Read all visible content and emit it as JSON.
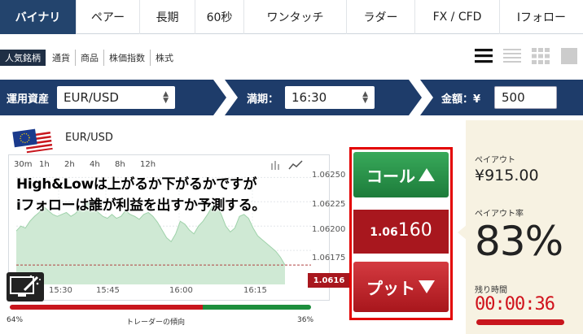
{
  "tabs": [
    {
      "label": "バイナリ",
      "active": true
    },
    {
      "label": "ペアー",
      "active": false
    },
    {
      "label": "長期",
      "active": false
    },
    {
      "label": "60秒",
      "active": false
    },
    {
      "label": "ワンタッチ",
      "active": false
    },
    {
      "label": "ラダー",
      "active": false
    },
    {
      "label": "FX / CFD",
      "active": false
    },
    {
      "label": "Iフォロー",
      "active": false
    }
  ],
  "subnav": {
    "items": [
      "人気銘柄",
      "通貨",
      "商品",
      "株価指数",
      "株式"
    ],
    "active": 0,
    "view_icons": [
      "list-view-icon",
      "compact-list-icon",
      "grid-view-icon",
      "single-view-icon"
    ]
  },
  "controls": {
    "asset_label": "運用資産",
    "asset_value": "EUR/USD",
    "expiry_label": "満期：",
    "expiry_value": "16:30",
    "amount_label": "金額：¥",
    "amount_value": "500"
  },
  "instrument": {
    "pair": "EUR/USD",
    "flag": "eu-us-flag-icon"
  },
  "chart": {
    "timeframes": [
      "30m",
      "1h",
      "2h",
      "4h",
      "8h",
      "12h"
    ],
    "price_ticks": [
      "1.06250",
      "1.06225",
      "1.06200",
      "1.06175"
    ],
    "time_ticks": [
      "15:30",
      "15:45",
      "16:00",
      "16:15"
    ],
    "current_price": "1.0616"
  },
  "chart_data": {
    "type": "area",
    "x": [
      0,
      1,
      2,
      3,
      4,
      5,
      6,
      7,
      8,
      9,
      10,
      11,
      12,
      13,
      14,
      15,
      16,
      17,
      18,
      19,
      20,
      21,
      22,
      23,
      24,
      25,
      26,
      27,
      28,
      29,
      30,
      31,
      32,
      33,
      34,
      35,
      36,
      37,
      38,
      39,
      40,
      41,
      42,
      43,
      44,
      45,
      46,
      47,
      48,
      49,
      50,
      51,
      52,
      53,
      54,
      55,
      56,
      57,
      58,
      59
    ],
    "values": [
      1.06195,
      1.062,
      1.06198,
      1.06205,
      1.0621,
      1.06214,
      1.0622,
      1.06216,
      1.06212,
      1.0621,
      1.06212,
      1.06214,
      1.0621,
      1.06213,
      1.06218,
      1.06222,
      1.06224,
      1.0622,
      1.06214,
      1.0621,
      1.06208,
      1.06212,
      1.06208,
      1.0621,
      1.06216,
      1.06212,
      1.0621,
      1.06207,
      1.06212,
      1.06214,
      1.0621,
      1.06204,
      1.06196,
      1.06188,
      1.06184,
      1.06192,
      1.06205,
      1.06202,
      1.06196,
      1.06192,
      1.062,
      1.06205,
      1.06212,
      1.0622,
      1.06222,
      1.06212,
      1.062,
      1.06194,
      1.06198,
      1.0621,
      1.06212,
      1.06208,
      1.06198,
      1.0619,
      1.06186,
      1.06182,
      1.06178,
      1.06174,
      1.06168,
      1.0616
    ],
    "ylim": [
      1.0614,
      1.06262
    ],
    "xticks": [
      "15:30",
      "15:45",
      "16:00",
      "16:15"
    ],
    "yticks": [
      "1.06250",
      "1.06225",
      "1.06200",
      "1.06175"
    ],
    "grid": true
  },
  "overlay": {
    "line1": "High&Lowは上がるか下がるかですが",
    "line2": "iフォローは誰が利益を出すか予測する。"
  },
  "trader_trend": {
    "label": "トレーダーの傾向",
    "left": "64%",
    "right": "36%",
    "left_fraction": 0.64
  },
  "trade": {
    "call_label": "コール",
    "put_label": "プット",
    "price_prefix": "1.06",
    "price_main": "160"
  },
  "payout_panel": {
    "payout_label": "ペイアウト",
    "payout_value": "¥915.00",
    "rate_label": "ペイアウト率",
    "rate_value": "83%",
    "remaining_label": "残り時間",
    "remaining_value": "00:00:36"
  },
  "colors": {
    "navy": "#1e3c6a",
    "call_green": "#1d7c3b",
    "put_red": "#a8161c",
    "highlight": "#e30000",
    "panel_bg": "#f7f2e2"
  }
}
